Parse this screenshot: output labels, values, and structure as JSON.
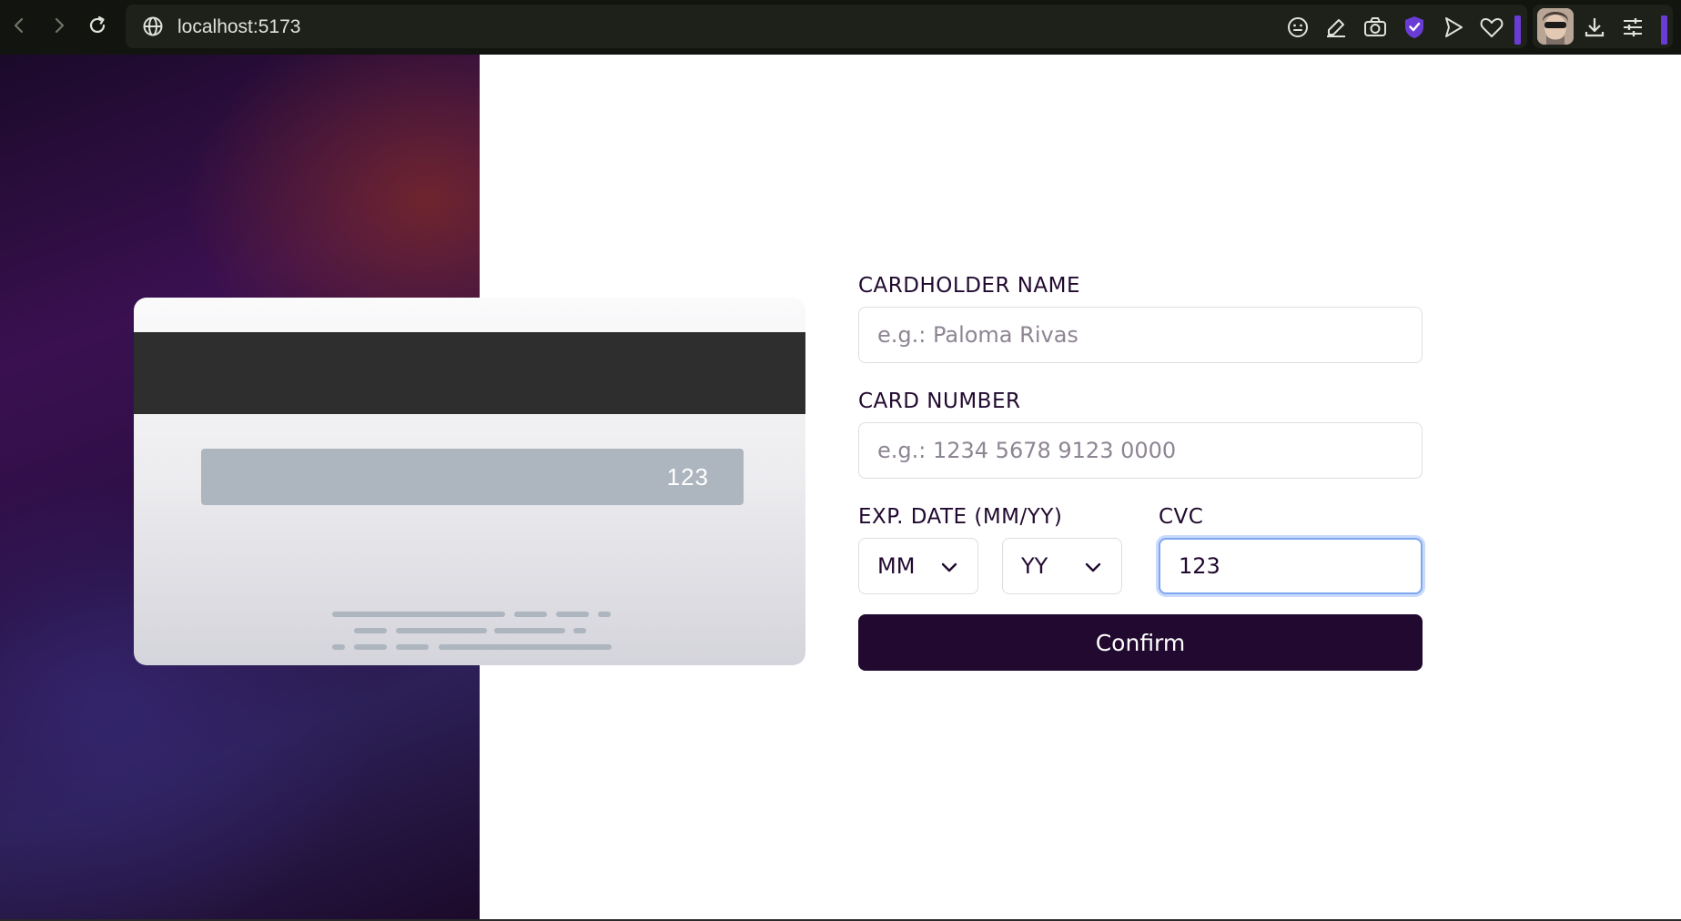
{
  "browser": {
    "url": "localhost:5173",
    "extension_icons": [
      "emoji-icon",
      "edit-icon",
      "camera-icon",
      "shield-icon",
      "send-icon",
      "heart-icon"
    ],
    "toolbar_icons": [
      "download-icon",
      "settings-sliders-icon"
    ],
    "accent_color": "#6a3cd6"
  },
  "card": {
    "cvc": "123"
  },
  "form": {
    "name": {
      "label": "CARDHOLDER NAME",
      "placeholder": "e.g.: Paloma Rivas",
      "value": ""
    },
    "number": {
      "label": "CARD NUMBER",
      "placeholder": "e.g.: 1234 5678 9123 0000",
      "value": ""
    },
    "exp": {
      "label": "EXP. DATE (MM/YY)",
      "month": "MM",
      "year": "YY"
    },
    "cvc": {
      "label": "CVC",
      "value": "123"
    },
    "confirm_label": "Confirm"
  },
  "colors": {
    "primary": "#21092f",
    "focus_ring": "#7fa6f0",
    "input_border": "#dedde3"
  }
}
